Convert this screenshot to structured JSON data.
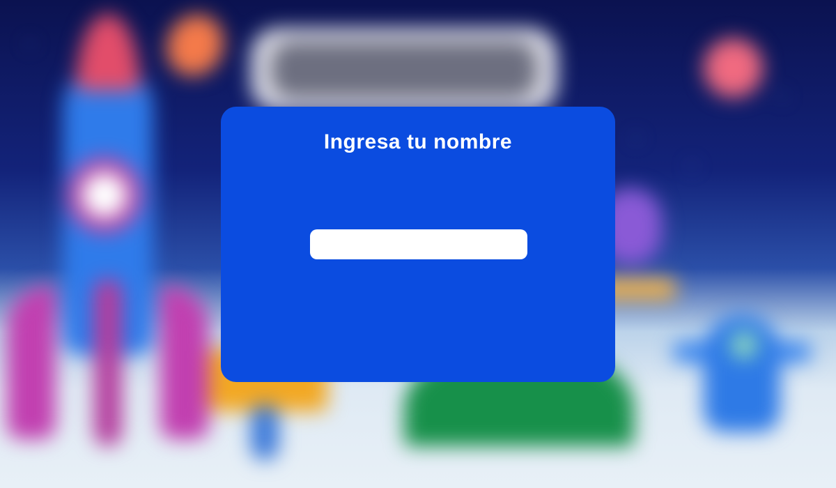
{
  "dialog": {
    "title": "Ingresa tu nombre",
    "name_input": {
      "value": "",
      "placeholder": ""
    }
  },
  "colors": {
    "dialog_background": "#0b4ce0",
    "dialog_text": "#ffffff",
    "input_background": "#ffffff"
  }
}
